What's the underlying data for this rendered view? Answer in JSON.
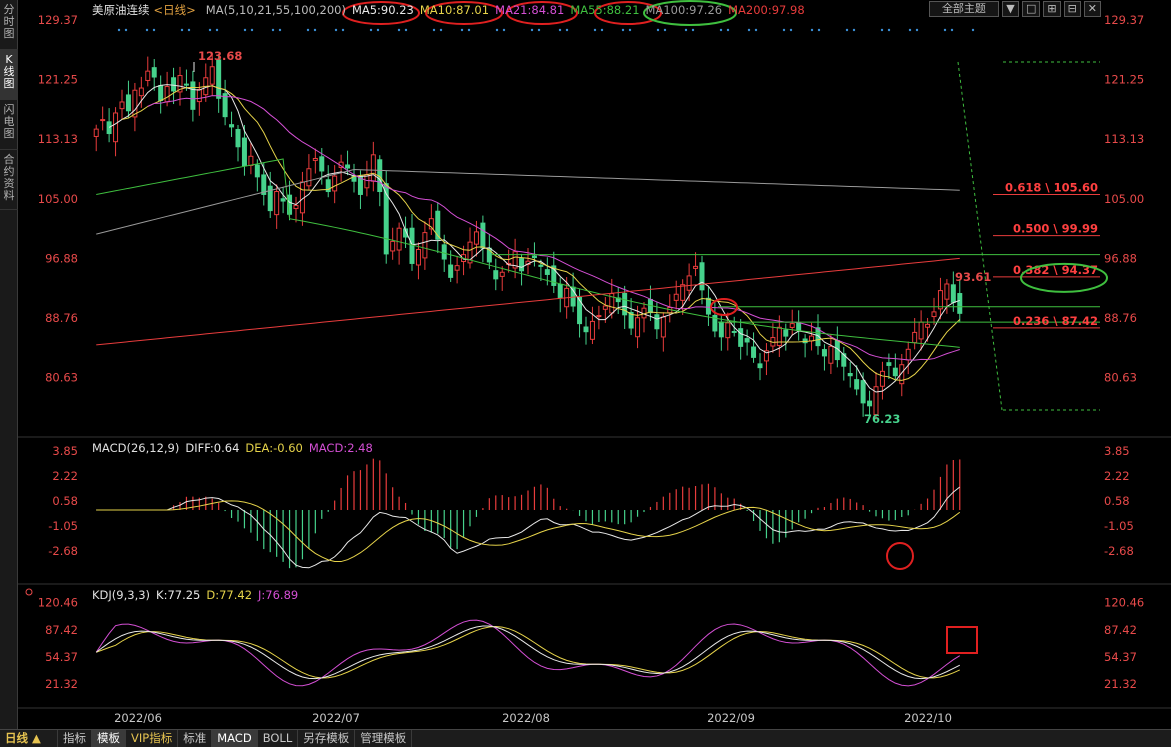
{
  "side_tabs": [
    "分时图",
    "K线图",
    "闪电图",
    "合约资料"
  ],
  "header": {
    "title": "美原油连续",
    "period": "<日线>",
    "ma_label": "MA(5,10,21,55,100,200)",
    "ma_values": [
      {
        "label": "MA5:90.23",
        "color": "#e8e8e8"
      },
      {
        "label": "MA10:87.01",
        "color": "#e6d34a"
      },
      {
        "label": "MA21:84.81",
        "color": "#d44fd4"
      },
      {
        "label": "MA55:88.21",
        "color": "#3fbf3f"
      },
      {
        "label": "MA100:97.26",
        "color": "#9a9a9a"
      },
      {
        "label": "MA200:97.98",
        "color": "#e83c3c"
      }
    ],
    "toolbar": [
      "全部主题",
      "▼",
      "□",
      "⊞",
      "⊟",
      "✕"
    ]
  },
  "price_axis": [
    "129.37",
    "121.25",
    "113.13",
    "105.00",
    "96.88",
    "88.76",
    "80.63"
  ],
  "macd_axis": [
    "3.85",
    "2.22",
    "0.58",
    "-1.05",
    "-2.68"
  ],
  "kdj_axis": [
    "120.46",
    "87.42",
    "54.37",
    "21.32"
  ],
  "date_labels": [
    "2022/06",
    "2022/07",
    "2022/08",
    "2022/09",
    "2022/10"
  ],
  "annotations": {
    "high": "123.68",
    "low": "76.23",
    "recent_high": "93.61",
    "fib": [
      {
        "label": "0.618 \\ 105.60",
        "value": 105.6
      },
      {
        "label": "0.500 \\ 99.99",
        "value": 99.99
      },
      {
        "label": "0.382 \\ 94.37",
        "value": 94.37
      },
      {
        "label": "0.236 \\ 87.42",
        "value": 87.42
      }
    ]
  },
  "macd_header": {
    "name": "MACD(26,12,9)",
    "diff": "DIFF:0.64",
    "dea": "DEA:-0.60",
    "macd": "MACD:2.48"
  },
  "kdj_header": {
    "name": "KDJ(9,3,3)",
    "k": "K:77.25",
    "d": "D:77.42",
    "j": "J:76.89"
  },
  "bottom_bar": {
    "period_label": "日线 ▲",
    "tabs": [
      "指标",
      "模板",
      "VIP指标",
      "标准",
      "MACD",
      "BOLL",
      "另存模板",
      "管理模板"
    ]
  },
  "colors": {
    "up": "#e83c3c",
    "down": "#46d28c",
    "ma5": "#e8e8e8",
    "ma10": "#e6d34a",
    "ma21": "#d44fd4",
    "ma55": "#3fbf3f",
    "ma100": "#9a9a9a",
    "ma200": "#e83c3c"
  },
  "chart_data": {
    "type": "candlestick",
    "price_ylim": [
      76.23,
      129.37
    ],
    "candles_close": [
      114.5,
      115.8,
      113.9,
      116.7,
      118.2,
      117.0,
      119.8,
      120.1,
      122.4,
      121.6,
      118.4,
      120.3,
      119.7,
      121.8,
      120.5,
      117.2,
      119.9,
      121.5,
      123.0,
      118.7,
      116.2,
      114.8,
      112.1,
      109.5,
      110.8,
      108.0,
      105.6,
      103.4,
      106.0,
      104.7,
      102.9,
      104.1,
      107.3,
      109.1,
      110.5,
      108.8,
      106.0,
      108.1,
      110.0,
      109.2,
      107.4,
      105.6,
      108.3,
      111.0,
      106.0,
      97.5,
      99.2,
      101.0,
      99.8,
      96.2,
      98.1,
      100.4,
      102.3,
      99.5,
      96.8,
      94.3,
      95.9,
      97.4,
      99.1,
      100.5,
      98.3,
      96.4,
      94.1,
      95.0,
      96.2,
      97.8,
      95.2,
      96.5,
      97.0,
      95.8,
      94.7,
      93.2,
      91.5,
      92.8,
      90.4,
      88.0,
      86.9,
      88.3,
      89.1,
      90.4,
      92.1,
      91.0,
      89.2,
      87.4,
      88.8,
      90.1,
      89.5,
      87.3,
      88.9,
      90.2,
      92.0,
      93.3,
      94.5,
      95.8,
      92.6,
      89.3,
      87.0,
      86.2,
      88.1,
      86.9,
      84.9,
      85.5,
      83.4,
      82.0,
      84.3,
      86.1,
      87.5,
      86.3,
      88.0,
      87.1,
      85.4,
      86.3,
      85.0,
      83.6,
      84.9,
      83.1,
      82.2,
      80.9,
      79.1,
      77.2,
      76.8,
      79.4,
      81.5,
      82.3,
      80.9,
      82.4,
      84.5,
      86.8,
      88.2,
      87.9,
      89.6,
      92.5,
      93.4,
      90.9,
      89.4
    ],
    "ma_fib_lines": {
      "top": 97.4,
      "mid": 90.3,
      "low": 88.2
    }
  }
}
